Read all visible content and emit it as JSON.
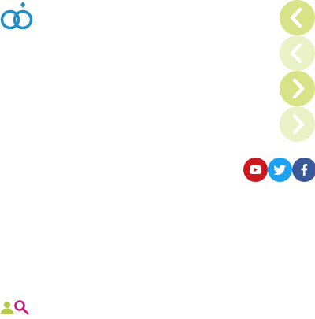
{
  "colors": {
    "brand_blue": "#1f8fc6",
    "nav_green": "#d6e487",
    "nav_green_faded": "#eaf1c6",
    "youtube": "#cc181e",
    "twitter": "#1da1f2",
    "facebook": "#3b5998",
    "user_green": "#b5c94a",
    "search_magenta": "#c21d7b"
  },
  "icons": {
    "logo": "rings-logo-icon",
    "nav": [
      "chevron-left-icon",
      "chevron-left-icon",
      "chevron-right-icon",
      "chevron-right-icon"
    ],
    "social": [
      "youtube-icon",
      "twitter-icon",
      "facebook-icon"
    ],
    "bottom": [
      "user-icon",
      "search-icon"
    ]
  }
}
